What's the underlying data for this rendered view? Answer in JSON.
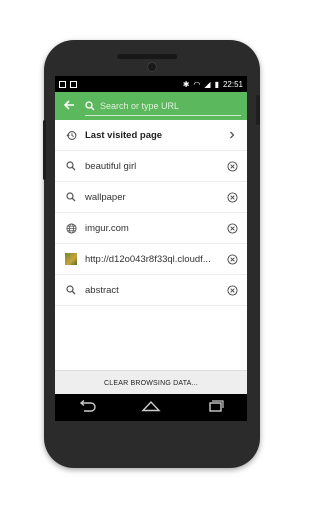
{
  "status_bar": {
    "time": "22:51"
  },
  "toolbar": {
    "search_placeholder": "Search or type URL"
  },
  "history": {
    "items": [
      {
        "label": "Last visited page",
        "icon": "history-icon",
        "action_icon": "chevron-right-icon"
      },
      {
        "label": "beautiful girl",
        "icon": "search-icon",
        "action_icon": "remove-icon"
      },
      {
        "label": "wallpaper",
        "icon": "search-icon",
        "action_icon": "remove-icon"
      },
      {
        "label": "imgur.com",
        "icon": "globe-icon",
        "action_icon": "remove-icon"
      },
      {
        "label": "http://d12o043r8f33ql.cloudf...",
        "icon": "site-thumbnail-icon",
        "action_icon": "remove-icon"
      },
      {
        "label": "abstract",
        "icon": "search-icon",
        "action_icon": "remove-icon"
      }
    ]
  },
  "footer": {
    "clear_label": "CLEAR BROWSING DATA..."
  },
  "colors": {
    "accent": "#5cb85c",
    "navbar": "#000000",
    "phone_body": "#2b2b2b"
  }
}
